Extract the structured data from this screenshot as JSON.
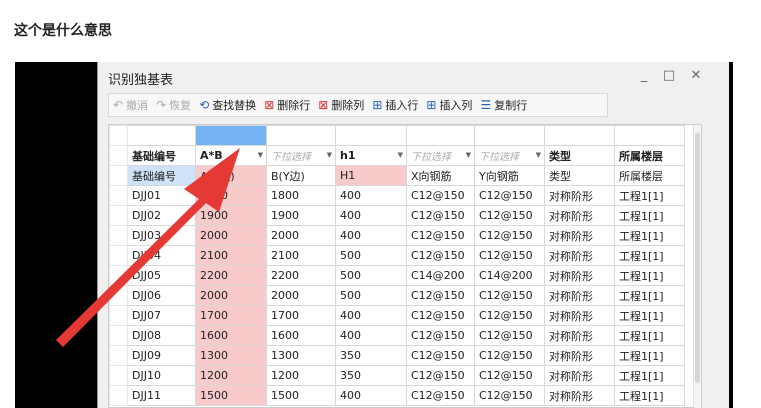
{
  "question": "这个是什么意思",
  "window": {
    "title": "识别独基表",
    "controls": [
      "_",
      "□",
      "✕"
    ]
  },
  "toolbar": [
    {
      "label": "撤消",
      "icon": "undo-icon",
      "disabled": true
    },
    {
      "label": "恢复",
      "icon": "redo-icon",
      "disabled": true
    },
    {
      "label": "查找替换",
      "icon": "find-replace-icon",
      "disabled": false
    },
    {
      "label": "删除行",
      "icon": "delete-row-icon",
      "disabled": false
    },
    {
      "label": "删除列",
      "icon": "delete-column-icon",
      "disabled": false
    },
    {
      "label": "插入行",
      "icon": "insert-row-icon",
      "disabled": false
    },
    {
      "label": "插入列",
      "icon": "insert-column-icon",
      "disabled": false
    },
    {
      "label": "复制行",
      "icon": "copy-row-icon",
      "disabled": false
    }
  ],
  "table": {
    "headers": [
      "基础编号",
      "A*B",
      "下拉选择",
      "h1",
      "下拉选择",
      "下拉选择",
      "类型",
      "所属楼层"
    ],
    "sub_row": [
      "基础编号",
      "A(X边)",
      "B(Y边)",
      "H1",
      "X向钢筋",
      "Y向钢筋",
      "类型",
      "所属楼层"
    ],
    "rows": [
      [
        "DJJ01",
        "1800",
        "1800",
        "400",
        "C12@150",
        "C12@150",
        "对称阶形",
        "工程1[1]"
      ],
      [
        "DJJ02",
        "1900",
        "1900",
        "400",
        "C12@150",
        "C12@150",
        "对称阶形",
        "工程1[1]"
      ],
      [
        "DJJ03",
        "2000",
        "2000",
        "400",
        "C12@150",
        "C12@150",
        "对称阶形",
        "工程1[1]"
      ],
      [
        "DJJ04",
        "2100",
        "2100",
        "500",
        "C12@150",
        "C12@150",
        "对称阶形",
        "工程1[1]"
      ],
      [
        "DJJ05",
        "2200",
        "2200",
        "500",
        "C14@200",
        "C14@200",
        "对称阶形",
        "工程1[1]"
      ],
      [
        "DJJ06",
        "2000",
        "2000",
        "500",
        "C12@150",
        "C12@150",
        "对称阶形",
        "工程1[1]"
      ],
      [
        "DJJ07",
        "1700",
        "1700",
        "400",
        "C12@150",
        "C12@150",
        "对称阶形",
        "工程1[1]"
      ],
      [
        "DJJ08",
        "1600",
        "1600",
        "400",
        "C12@150",
        "C12@150",
        "对称阶形",
        "工程1[1]"
      ],
      [
        "DJJ09",
        "1300",
        "1300",
        "350",
        "C12@150",
        "C12@150",
        "对称阶形",
        "工程1[1]"
      ],
      [
        "DJJ10",
        "1200",
        "1200",
        "350",
        "C12@150",
        "C12@150",
        "对称阶形",
        "工程1[1]"
      ],
      [
        "DJJ11",
        "1500",
        "1500",
        "400",
        "C12@150",
        "C12@150",
        "对称阶形",
        "工程1[1]"
      ]
    ]
  },
  "colors": {
    "selected_column": "#74b4f5",
    "highlight_cell": "#f8caca",
    "annotation_arrow": "#e53935"
  }
}
